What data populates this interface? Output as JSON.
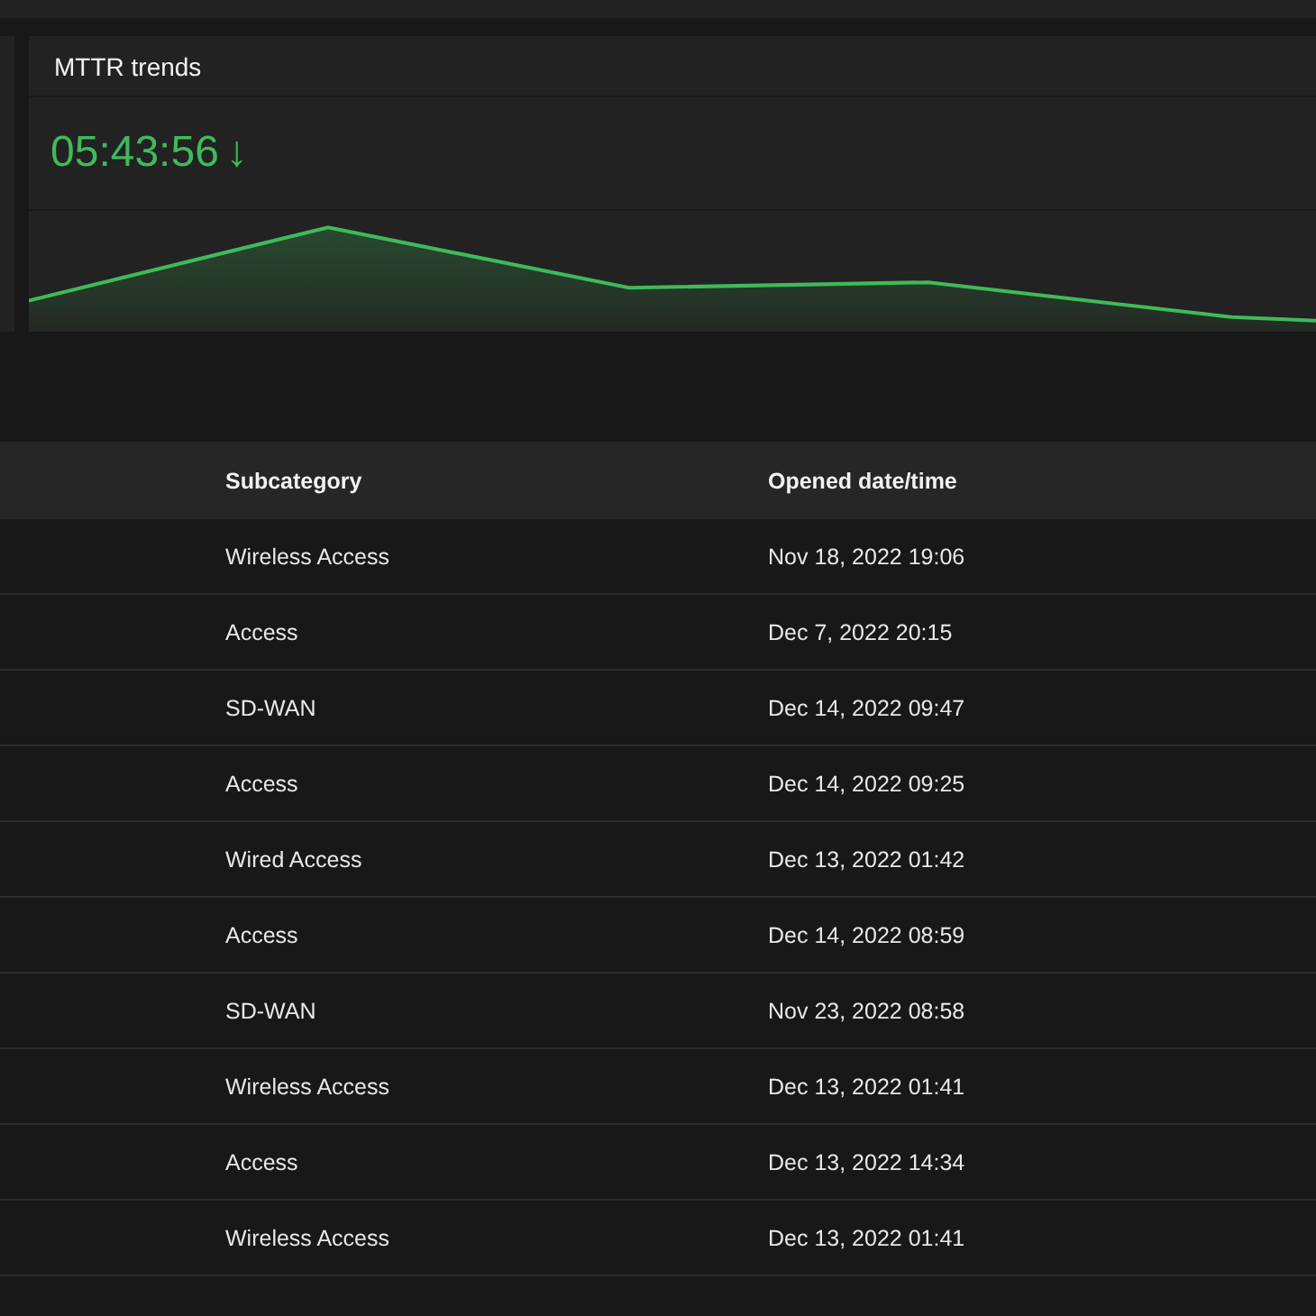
{
  "mttr_card": {
    "title": "MTTR trends",
    "value": "05:43:56",
    "trend_arrow": "↓"
  },
  "table": {
    "columns": [
      "Subcategory",
      "Opened date/time"
    ],
    "rows": [
      {
        "subcategory": "Wireless Access",
        "opened": "Nov 18, 2022 19:06"
      },
      {
        "subcategory": "Access",
        "opened": "Dec 7, 2022 20:15"
      },
      {
        "subcategory": "SD-WAN",
        "opened": "Dec 14, 2022 09:47"
      },
      {
        "subcategory": "Access",
        "opened": "Dec 14, 2022 09:25"
      },
      {
        "subcategory": "Wired Access",
        "opened": "Dec 13, 2022 01:42"
      },
      {
        "subcategory": "Access",
        "opened": "Dec 14, 2022 08:59"
      },
      {
        "subcategory": "SD-WAN",
        "opened": "Nov 23, 2022 08:58"
      },
      {
        "subcategory": "Wireless Access",
        "opened": "Dec 13, 2022 01:41"
      },
      {
        "subcategory": "Access",
        "opened": "Dec 13, 2022 14:34"
      },
      {
        "subcategory": "Wireless Access",
        "opened": "Dec 13, 2022 01:41"
      }
    ]
  }
}
